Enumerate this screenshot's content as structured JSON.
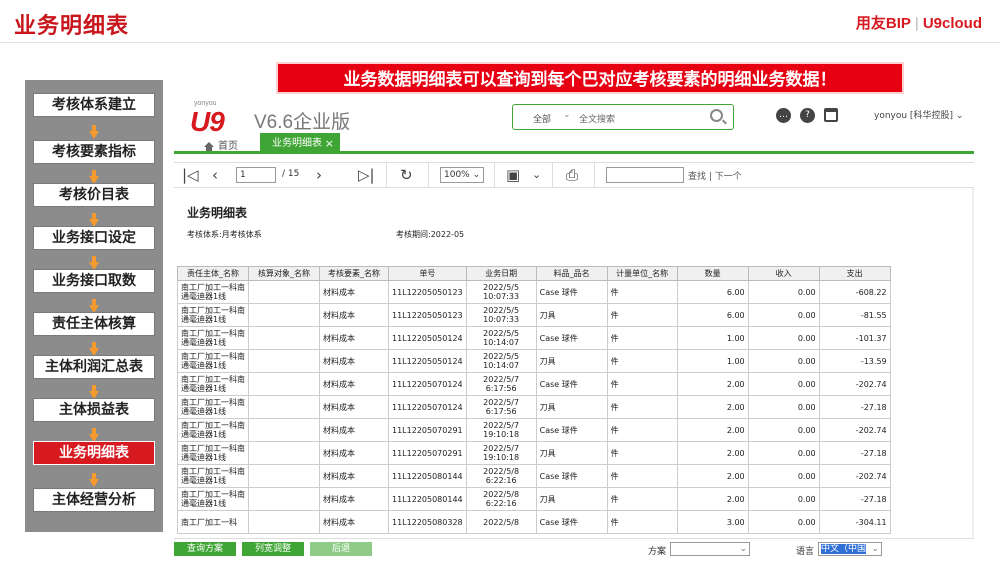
{
  "slide": {
    "title": "业务明细表",
    "brand_left": "用友BIP",
    "brand_right": "U9cloud",
    "banner": "业务数据明细表可以查询到每个巴对应考核要素的明细业务数据！"
  },
  "flow": {
    "items": [
      {
        "label": "考核体系建立",
        "active": false
      },
      {
        "label": "考核要素指标",
        "active": false
      },
      {
        "label": "考核价目表",
        "active": false
      },
      {
        "label": "业务接口设定",
        "active": false
      },
      {
        "label": "业务接口取数",
        "active": false
      },
      {
        "label": "责任主体核算",
        "active": false
      },
      {
        "label": "主体利润汇总表",
        "active": false
      },
      {
        "label": "主体损益表",
        "active": false
      },
      {
        "label": "业务明细表",
        "active": true
      },
      {
        "label": "主体经营分析",
        "active": false
      }
    ]
  },
  "app": {
    "logo_small": "yonyou",
    "logo": "U9",
    "version": "V6.6企业版",
    "search": {
      "scope": "全部",
      "placeholder": "全文搜索"
    },
    "user": "yonyou [科华控股] ⌄",
    "tabs": {
      "home": "首页",
      "active": "业务明细表"
    },
    "toolbar": {
      "page": "1",
      "total": "/ 15",
      "zoom": "100% ⌄",
      "find_label": "查找 | 下一个"
    },
    "report": {
      "title": "业务明细表",
      "system": "考核体系:月考核体系",
      "period": "考核期间:2022-05"
    },
    "columns": [
      "责任主体_名称",
      "核算对象_名称",
      "考核要素_名称",
      "单号",
      "业务日期",
      "料品_品名",
      "计量单位_名称",
      "数量",
      "收入",
      "支出"
    ],
    "rows": [
      {
        "entity": "南工厂加工一科南通毫迪器1线",
        "object": "",
        "element": "材料成本",
        "doc": "11L12205050123",
        "date": "2022/5/5",
        "time": "10:07:33",
        "item": "Case 球件",
        "unit": "件",
        "qty": "6.00",
        "income": "0.00",
        "expense": "-608.22"
      },
      {
        "entity": "南工厂加工一科南通毫迪器1线",
        "object": "",
        "element": "材料成本",
        "doc": "11L12205050123",
        "date": "2022/5/5",
        "time": "10:07:33",
        "item": "刀具",
        "unit": "件",
        "qty": "6.00",
        "income": "0.00",
        "expense": "-81.55"
      },
      {
        "entity": "南工厂加工一科南通毫迪器1线",
        "object": "",
        "element": "材料成本",
        "doc": "11L12205050124",
        "date": "2022/5/5",
        "time": "10:14:07",
        "item": "Case 球件",
        "unit": "件",
        "qty": "1.00",
        "income": "0.00",
        "expense": "-101.37"
      },
      {
        "entity": "南工厂加工一科南通毫迪器1线",
        "object": "",
        "element": "材料成本",
        "doc": "11L12205050124",
        "date": "2022/5/5",
        "time": "10:14:07",
        "item": "刀具",
        "unit": "件",
        "qty": "1.00",
        "income": "0.00",
        "expense": "-13.59"
      },
      {
        "entity": "南工厂加工一科南通毫迪器1线",
        "object": "",
        "element": "材料成本",
        "doc": "11L12205070124",
        "date": "2022/5/7",
        "time": "6:17:56",
        "item": "Case 球件",
        "unit": "件",
        "qty": "2.00",
        "income": "0.00",
        "expense": "-202.74"
      },
      {
        "entity": "南工厂加工一科南通毫迪器1线",
        "object": "",
        "element": "材料成本",
        "doc": "11L12205070124",
        "date": "2022/5/7",
        "time": "6:17:56",
        "item": "刀具",
        "unit": "件",
        "qty": "2.00",
        "income": "0.00",
        "expense": "-27.18"
      },
      {
        "entity": "南工厂加工一科南通毫迪器1线",
        "object": "",
        "element": "材料成本",
        "doc": "11L12205070291",
        "date": "2022/5/7",
        "time": "19:10:18",
        "item": "Case 球件",
        "unit": "件",
        "qty": "2.00",
        "income": "0.00",
        "expense": "-202.74"
      },
      {
        "entity": "南工厂加工一科南通毫迪器1线",
        "object": "",
        "element": "材料成本",
        "doc": "11L12205070291",
        "date": "2022/5/7",
        "time": "19:10:18",
        "item": "刀具",
        "unit": "件",
        "qty": "2.00",
        "income": "0.00",
        "expense": "-27.18"
      },
      {
        "entity": "南工厂加工一科南通毫迪器1线",
        "object": "",
        "element": "材料成本",
        "doc": "11L12205080144",
        "date": "2022/5/8",
        "time": "6:22:16",
        "item": "Case 球件",
        "unit": "件",
        "qty": "2.00",
        "income": "0.00",
        "expense": "-202.74"
      },
      {
        "entity": "南工厂加工一科南通毫迪器1线",
        "object": "",
        "element": "材料成本",
        "doc": "11L12205080144",
        "date": "2022/5/8",
        "time": "6:22:16",
        "item": "刀具",
        "unit": "件",
        "qty": "2.00",
        "income": "0.00",
        "expense": "-27.18"
      },
      {
        "entity": "南工厂加工一科",
        "object": "",
        "element": "材料成本",
        "doc": "11L12205080328",
        "date": "2022/5/8",
        "time": "",
        "item": "Case 球件",
        "unit": "件",
        "qty": "3.00",
        "income": "0.00",
        "expense": "-304.11"
      }
    ],
    "bottom": {
      "btn_query": "查询方案",
      "btn_width": "列宽调整",
      "btn_back": "后退",
      "scheme_label": "方案",
      "lang_label": "语言",
      "lang_value": "中文（中国"
    }
  }
}
